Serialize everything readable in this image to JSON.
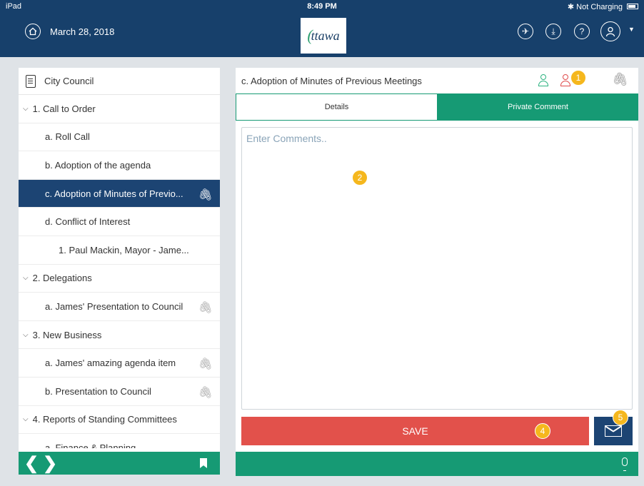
{
  "status_bar": {
    "device": "iPad",
    "time": "8:49 PM",
    "charging": "Not Charging"
  },
  "header": {
    "date": "March 28, 2018",
    "logo_text": "ttawa",
    "brand_color": "#17406b"
  },
  "sidebar": {
    "title": "City Council",
    "items": [
      {
        "label": "1. Call to Order",
        "level": 0,
        "expanded": true,
        "attachment": false,
        "selected": false
      },
      {
        "label": "a. Roll Call",
        "level": 1,
        "attachment": false,
        "selected": false
      },
      {
        "label": "b. Adoption of the agenda",
        "level": 1,
        "attachment": false,
        "selected": false
      },
      {
        "label": "c. Adoption of Minutes of Previo...",
        "level": 1,
        "attachment": true,
        "selected": true
      },
      {
        "label": "d. Conflict of Interest",
        "level": 1,
        "attachment": false,
        "selected": false
      },
      {
        "label": "1. Paul Mackin, Mayor - Jame...",
        "level": 2,
        "attachment": false,
        "selected": false
      },
      {
        "label": "2. Delegations",
        "level": 0,
        "expanded": true,
        "attachment": false,
        "selected": false
      },
      {
        "label": "a. James' Presentation to Council",
        "level": 1,
        "attachment": true,
        "selected": false
      },
      {
        "label": "3. New Business",
        "level": 0,
        "expanded": true,
        "attachment": false,
        "selected": false
      },
      {
        "label": "a. James' amazing agenda item",
        "level": 1,
        "attachment": true,
        "selected": false
      },
      {
        "label": "b. Presentation to Council",
        "level": 1,
        "attachment": true,
        "selected": false
      },
      {
        "label": "4. Reports of Standing Committees",
        "level": 0,
        "expanded": true,
        "attachment": false,
        "selected": false
      },
      {
        "label": "a. Finance & Planning",
        "level": 1,
        "attachment": false,
        "selected": false
      }
    ]
  },
  "main": {
    "title": "c. Adoption of Minutes of Previous Meetings",
    "tabs": [
      {
        "label": "Details",
        "active": false
      },
      {
        "label": "Private Comment",
        "active": true
      }
    ],
    "comment_placeholder": "Enter Comments..",
    "save_label": "SAVE",
    "badges": [
      "1",
      "2",
      "4",
      "5"
    ]
  },
  "colors": {
    "accent_green": "#169a74",
    "save_red": "#e2514b",
    "selected_blue": "#1c4473",
    "badge_yellow": "#f5b71d"
  }
}
